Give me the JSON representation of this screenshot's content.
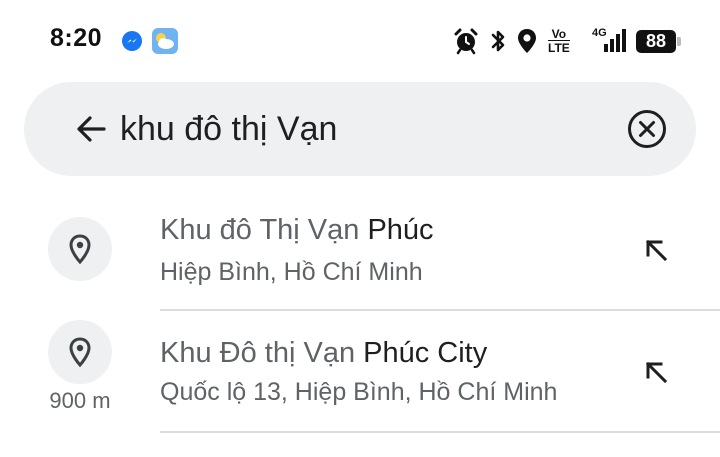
{
  "status_bar": {
    "time": "8:20",
    "volte_top": "Vo",
    "volte_bottom": "LTE",
    "network": "4G",
    "battery": "88",
    "icons": [
      "messenger-icon",
      "weather-icon",
      "alarm-icon",
      "bluetooth-icon",
      "location-icon",
      "volte-icon",
      "signal-icon",
      "battery-icon"
    ]
  },
  "search": {
    "query": "khu đô thị Vạn",
    "back_icon": "back-arrow-icon",
    "clear_icon": "clear-circle-icon"
  },
  "results": [
    {
      "title_match": "Khu đô Thị Vạn",
      "title_rest": " Phúc",
      "subtitle": "Hiệp Bình, Hồ Chí Minh",
      "distance": "",
      "icon": "location-pin-icon",
      "action_icon": "fill-query-arrow-icon"
    },
    {
      "title_match": "Khu Đô thị Vạn",
      "title_rest": " Phúc City",
      "subtitle": "Quốc lộ 13, Hiệp Bình, Hồ Chí Minh",
      "distance": "900 m",
      "icon": "location-pin-icon",
      "action_icon": "fill-query-arrow-icon"
    }
  ],
  "colors": {
    "search_background": "#eef0f2",
    "secondary_text": "#5f6368",
    "primary_text": "#1f1f1f",
    "divider": "#dadce0",
    "messenger_blue": "#1877f2"
  }
}
